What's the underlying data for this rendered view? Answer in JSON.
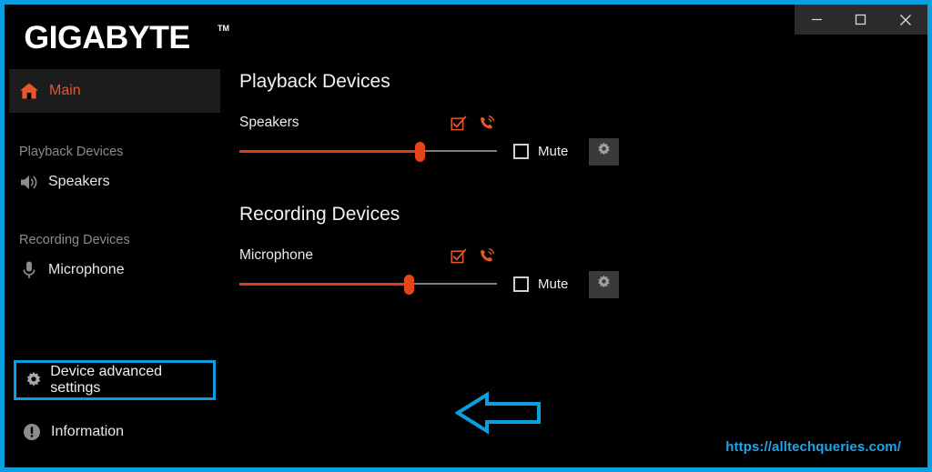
{
  "window": {
    "accent_border_color": "#0b9fe0",
    "background_color": "#000000",
    "controls": {
      "minimize_label": "Minimize",
      "maximize_label": "Maximize",
      "close_label": "Close"
    }
  },
  "brand": {
    "logo_text": "GIGABYTE",
    "trademark": "TM"
  },
  "sidebar": {
    "main": {
      "label": "Main",
      "icon": "home-icon",
      "active": true,
      "active_color": "#e8562a"
    },
    "groups": [
      {
        "title": "Playback Devices",
        "items": [
          {
            "label": "Speakers",
            "icon": "speaker-icon"
          }
        ]
      },
      {
        "title": "Recording Devices",
        "items": [
          {
            "label": "Microphone",
            "icon": "microphone-icon"
          }
        ]
      }
    ],
    "footer_items": [
      {
        "label": "Device advanced settings",
        "icon": "gear-icon",
        "highlighted": true,
        "highlight_color": "#0b9fe0"
      },
      {
        "label": "Information",
        "icon": "info-icon",
        "highlighted": false
      }
    ]
  },
  "main": {
    "sections": [
      {
        "title": "Playback Devices",
        "device": {
          "name": "Speakers",
          "default_device_icon": "checkbox-check-icon",
          "default_comm_icon": "phone-call-icon",
          "icon_color": "#e8562a",
          "volume_percent": 70,
          "mute_label": "Mute",
          "mute_checked": false,
          "settings_icon": "gear-icon"
        }
      },
      {
        "title": "Recording Devices",
        "device": {
          "name": "Microphone",
          "default_device_icon": "checkbox-check-icon",
          "default_comm_icon": "phone-call-icon",
          "icon_color": "#e8562a",
          "volume_percent": 66,
          "mute_label": "Mute",
          "mute_checked": false,
          "settings_icon": "gear-icon"
        }
      }
    ]
  },
  "annotation": {
    "arrow": "left-arrow-annotation",
    "arrow_color": "#0b9fe0"
  },
  "watermark": {
    "text": "https://alltechqueries.com/",
    "color": "#1fa4e8"
  }
}
